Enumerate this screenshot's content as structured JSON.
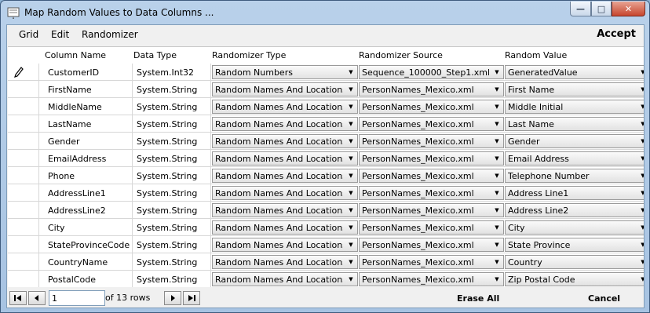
{
  "window": {
    "title": "Map Random Values to Data Columns ..."
  },
  "menu": {
    "grid": "Grid",
    "edit": "Edit",
    "randomizer": "Randomizer",
    "accept": "Accept"
  },
  "columns": {
    "column_name": "Column Name",
    "data_type": "Data Type",
    "randomizer_type": "Randomizer Type",
    "randomizer_source": "Randomizer Source",
    "random_value": "Random Value"
  },
  "rows": [
    {
      "column_name": "CustomerID",
      "data_type": "System.Int32",
      "randomizer_type": "Random Numbers",
      "randomizer_source": "Sequence_100000_Step1.xml",
      "random_value": "GeneratedValue"
    },
    {
      "column_name": "FirstName",
      "data_type": "System.String",
      "randomizer_type": "Random Names And Locations",
      "randomizer_source": "PersonNames_Mexico.xml",
      "random_value": "First Name"
    },
    {
      "column_name": "MiddleName",
      "data_type": "System.String",
      "randomizer_type": "Random Names And Locations",
      "randomizer_source": "PersonNames_Mexico.xml",
      "random_value": "Middle Initial"
    },
    {
      "column_name": "LastName",
      "data_type": "System.String",
      "randomizer_type": "Random Names And Locations",
      "randomizer_source": "PersonNames_Mexico.xml",
      "random_value": "Last Name"
    },
    {
      "column_name": "Gender",
      "data_type": "System.String",
      "randomizer_type": "Random Names And Locations",
      "randomizer_source": "PersonNames_Mexico.xml",
      "random_value": "Gender"
    },
    {
      "column_name": "EmailAddress",
      "data_type": "System.String",
      "randomizer_type": "Random Names And Locations",
      "randomizer_source": "PersonNames_Mexico.xml",
      "random_value": "Email Address"
    },
    {
      "column_name": "Phone",
      "data_type": "System.String",
      "randomizer_type": "Random Names And Locations",
      "randomizer_source": "PersonNames_Mexico.xml",
      "random_value": "Telephone Number"
    },
    {
      "column_name": "AddressLine1",
      "data_type": "System.String",
      "randomizer_type": "Random Names And Locations",
      "randomizer_source": "PersonNames_Mexico.xml",
      "random_value": "Address Line1"
    },
    {
      "column_name": "AddressLine2",
      "data_type": "System.String",
      "randomizer_type": "Random Names And Locations",
      "randomizer_source": "PersonNames_Mexico.xml",
      "random_value": "Address Line2"
    },
    {
      "column_name": "City",
      "data_type": "System.String",
      "randomizer_type": "Random Names And Locations",
      "randomizer_source": "PersonNames_Mexico.xml",
      "random_value": "City"
    },
    {
      "column_name": "StateProvinceCode",
      "data_type": "System.String",
      "randomizer_type": "Random Names And Locations",
      "randomizer_source": "PersonNames_Mexico.xml",
      "random_value": "State Province"
    },
    {
      "column_name": "CountryName",
      "data_type": "System.String",
      "randomizer_type": "Random Names And Locations",
      "randomizer_source": "PersonNames_Mexico.xml",
      "random_value": "Country"
    },
    {
      "column_name": "PostalCode",
      "data_type": "System.String",
      "randomizer_type": "Random Names And Locations",
      "randomizer_source": "PersonNames_Mexico.xml",
      "random_value": "Zip Postal Code"
    }
  ],
  "navigator": {
    "position": "1",
    "of_rows": "of 13 rows"
  },
  "footer": {
    "erase_all": "Erase All",
    "cancel": "Cancel"
  }
}
